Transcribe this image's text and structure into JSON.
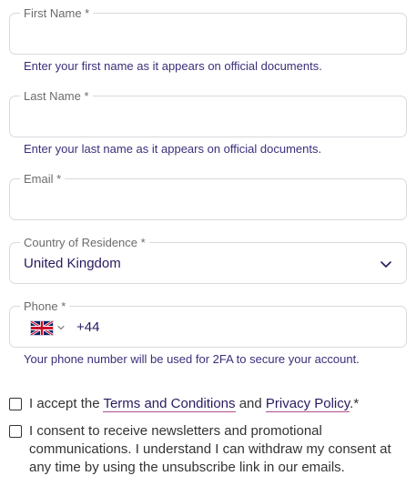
{
  "form": {
    "first_name": {
      "label": "First Name *",
      "value": "",
      "helper": "Enter your first name as it appears on official documents."
    },
    "last_name": {
      "label": "Last Name *",
      "value": "",
      "helper": "Enter your last name as it appears on official documents."
    },
    "email": {
      "label": "Email *",
      "value": ""
    },
    "country": {
      "label": "Country of Residence *",
      "value": "United Kingdom",
      "icon": "chevron-down-icon"
    },
    "phone": {
      "label": "Phone *",
      "flag_icon": "uk-flag-icon",
      "dial_code": "+44",
      "helper": "Your phone number will be used for 2FA to secure your account."
    },
    "terms": {
      "prefix": "I accept the ",
      "terms_link": "Terms and Conditions",
      "middle": " and ",
      "privacy_link": "Privacy Policy",
      "suffix": ".*",
      "checked": false
    },
    "newsletter": {
      "text": "I consent to receive newsletters and promotional communications. I understand I can withdraw my consent at any time by using the unsubscribe link in our emails.",
      "checked": false
    }
  },
  "colors": {
    "text": "#2a1a5e",
    "helper": "#3a2f7a",
    "border": "#d9d9e0",
    "link_underline": "#b0508a"
  }
}
